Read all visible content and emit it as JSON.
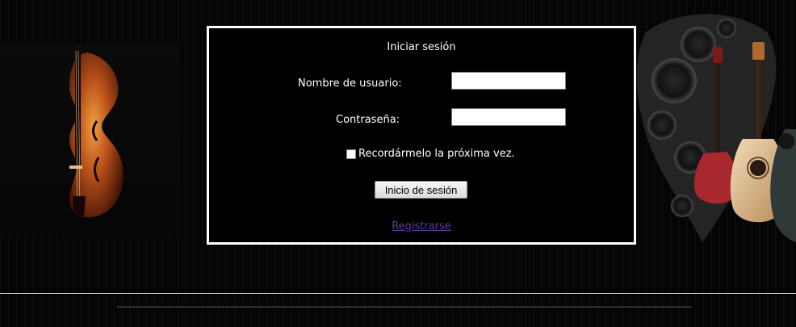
{
  "login": {
    "title": "Iniciar sesión",
    "username_label": "Nombre de usuario:",
    "username_value": "",
    "password_label": "Contraseña:",
    "password_value": "",
    "remember_label": "Recordármelo la próxima vez.",
    "remember_checked": false,
    "submit_label": "Inicio de sesión",
    "register_label": "Registrarse"
  },
  "footer": {
    "tildes": "~~~~~~~~~~~~~~~~~~~~~~~~~~~~~~~~~~~~~~~~~~~~~~~~~~~~~~~~~~~~~~~~~~~~~~~~~~~~~~~~~~~~~~~~~~~~~~~~~~~~~~~~~~~~~~~~~~~~~~~~~~~~~~~~~~~~~~~~~~~~~~~~~~~~~~~~~~~~~~~~~~~~~~~~~~~~~~~~~~~~~~~~~~~~~~~~~~~~~"
  },
  "colors": {
    "page_background": "#000000",
    "box_border": "#ffffff",
    "link": "#5b3d9c"
  },
  "icons": {
    "left_decoration": "violin-image",
    "right_decoration": "guitars-image",
    "remember": "checkbox"
  }
}
